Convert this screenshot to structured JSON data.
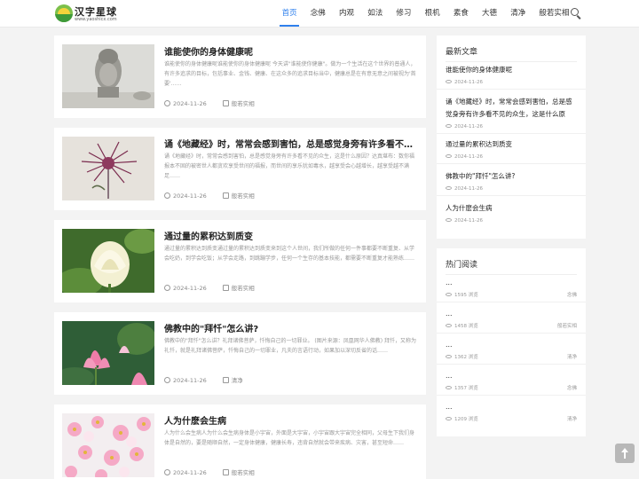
{
  "site": {
    "name": "汉字星球",
    "url": "www.yaoshicx.com"
  },
  "nav": [
    "首页",
    "念佛",
    "内观",
    "如法",
    "修习",
    "根机",
    "素食",
    "大德",
    "清净",
    "般若实相"
  ],
  "articles": [
    {
      "title": "谁能使你的身体健康呢",
      "excerpt": "谁能使你的身体健康呢谁能使你的身体健康呢 今天讲\"谁能使你健康\"。做为一个生活在这个世界的普通人，有许多追求的目标，包括事业、金钱、健康、在这众多的追求目标当中，健康总是在有意无意之间被视为'首要'……",
      "date": "2024-11-26",
      "category": "般若实相"
    },
    {
      "title": "诵《地藏经》时，常常会感到害怕，总是感觉身旁有许多看不见的众生，这是什么原因？",
      "excerpt": "诵《地藏经》时，常常会感到害怕，总是感觉身旁有许多看不见的众生，这是什么原因？达真堪布：数你福报本不固的被密世人都贪欢享受世间的福报，而世间的享乐犹如毒水，越享受会心越增长，越享受越不满足……",
      "date": "2024-11-26",
      "category": "般若实相"
    },
    {
      "title": "通过量的累积达到质变",
      "excerpt": "通过量的累积达到质变通过量的累积达到质变来到这个人世间，我们所做的任何一件事都要不断重复、从学会吃奶，到学会吃饭；从学会走路，到跳蹦学步，任何一个生存的基本技能，都需要不断重复才能熟练……",
      "date": "2024-11-26",
      "category": "般若实相"
    },
    {
      "title": "佛教中的\"拜忏\"怎么讲?",
      "excerpt": "佛教中的\"拜忏\"怎么讲？礼拜诸佛菩萨，忏悔自己的一切罪业。 (图片来源：凤凰网华人佛教) 拜忏，又称为礼忏，就是礼拜诸佛菩萨，忏悔自己的一切罪业，凡夫的言语行动，如果加以深切反省的话……",
      "date": "2024-11-26",
      "category": "清净"
    },
    {
      "title": "人为什麽会生病",
      "excerpt": "人为什么会生病人为什么会生病身体是小宇宙，外面是大宇宙，小宇宙跟大宇宙完全相同，父母生下我们身体是自然的，要是随顺自然，一定身体健康，健康长寿，违背自然就会带来疾病、灾害，甚至短命……",
      "date": "2024-11-26",
      "category": "般若实相"
    }
  ],
  "latest": {
    "title": "最新文章",
    "items": [
      {
        "title": "谁能使你的身体健康呢",
        "date": "2024-11-26"
      },
      {
        "title": "诵《地藏经》时，常常会感到害怕，总是感觉身旁有许多看不见的众生，这是什么原因？",
        "date": "2024-11-26"
      },
      {
        "title": "通过量的累积达到质变",
        "date": "2024-11-26"
      },
      {
        "title": "佛教中的\"拜忏\"怎么讲?",
        "date": "2024-11-26"
      },
      {
        "title": "人为什麽会生病",
        "date": "2024-11-26"
      }
    ]
  },
  "hot": {
    "title": "热门阅读",
    "items": [
      {
        "title": "…",
        "views": "1595 浏览",
        "category": "念佛"
      },
      {
        "title": "…",
        "views": "1458 浏览",
        "category": "般若实相"
      },
      {
        "title": "…",
        "views": "1362 浏览",
        "category": "清净"
      },
      {
        "title": "…",
        "views": "1357 浏览",
        "category": "念佛"
      },
      {
        "title": "…",
        "views": "1209 浏览",
        "category": "清净"
      }
    ]
  }
}
